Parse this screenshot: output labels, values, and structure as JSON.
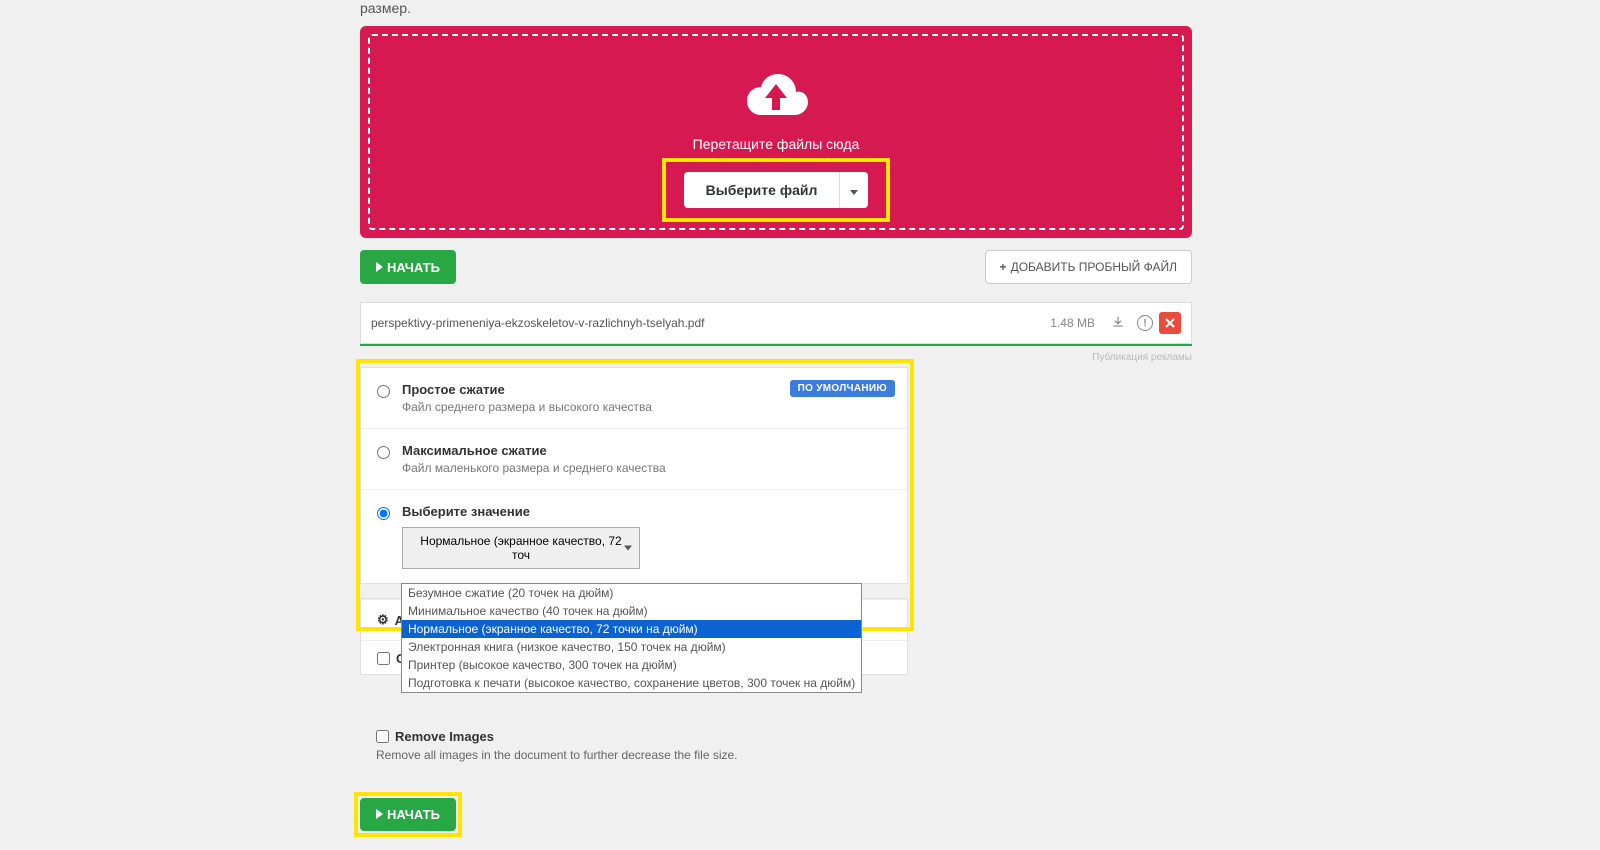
{
  "intro_fragment": "размер.",
  "dropzone": {
    "drag_text": "Перетащите файлы сюда",
    "select_file_label": "Выберите файл"
  },
  "actions": {
    "start_label": "НАЧАТЬ",
    "add_sample_label": "ДОБАВИТЬ ПРОБНЫЙ ФАЙЛ"
  },
  "file": {
    "name": "perspektivy-primeneniya-ekzoskeletov-v-razlichnyh-tselyah.pdf",
    "size": "1.48 MB"
  },
  "ad_label": "Публикация рекламы",
  "compression_options": {
    "opt1": {
      "title": "Простое сжатие",
      "desc": "Файл среднего размера и высокого качества",
      "default_badge": "ПО УМОЛЧАНИЮ"
    },
    "opt2": {
      "title": "Максимальное сжатие",
      "desc": "Файл маленького размера и среднего качества"
    },
    "opt3": {
      "title": "Выберите значение",
      "selected_preset": "Нормальное (экранное качество, 72 точ"
    }
  },
  "dropdown_options": {
    "o0": "Безумное сжатие (20 точек на дюйм)",
    "o1": "Минимальное качество (40 точек на дюйм)",
    "o2": "Нормальное (экранное качество, 72 точки на дюйм)",
    "o3": "Электронная книга (низкое качество, 150 точек на дюйм)",
    "o4": "Принтер (высокое качество, 300 точек на дюйм)",
    "o5": "Подготовка к печати (высокое качество, сохранение цветов, 300 точек на дюйм)"
  },
  "additional": {
    "title_prefix": "Ad",
    "grayscale_prefix": "Gr"
  },
  "remove_images": {
    "label": "Remove Images",
    "desc": "Remove all images in the document to further decrease the file size."
  }
}
